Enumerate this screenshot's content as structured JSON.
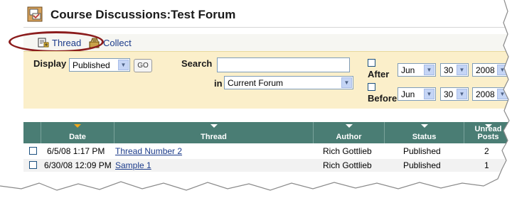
{
  "title": "Course Discussions:Test Forum",
  "actions": [
    {
      "label": "Thread",
      "icon": "new-thread-icon"
    },
    {
      "label": "Collect",
      "icon": "collect-icon"
    }
  ],
  "filters": {
    "display_label": "Display",
    "display_value": "Published",
    "go_label": "GO",
    "search_label": "Search",
    "search_value": "",
    "in_label": "in",
    "in_value": "Current Forum",
    "after_label": "After",
    "before_label": "Before",
    "after_date": {
      "month": "Jun",
      "day": "30",
      "year": "2008"
    },
    "before_date": {
      "month": "Jun",
      "day": "30",
      "year": "2008"
    }
  },
  "table": {
    "columns": [
      "Date",
      "Thread",
      "Author",
      "Status",
      "Unread",
      "Posts"
    ],
    "rows": [
      {
        "date": "6/5/08 1:17 PM",
        "thread": "Thread Number 2",
        "author": "Rich Gottlieb",
        "status": "Published",
        "unread": "2"
      },
      {
        "date": "6/30/08 12:09 PM",
        "thread": "Sample 1",
        "author": "Rich Gottlieb",
        "status": "Published",
        "unread": "1"
      }
    ]
  },
  "colors": {
    "header_bg": "#4a7d74",
    "filter_bg": "#fbefca",
    "highlight": "#8b1c1c",
    "link": "#1a3a8a"
  }
}
